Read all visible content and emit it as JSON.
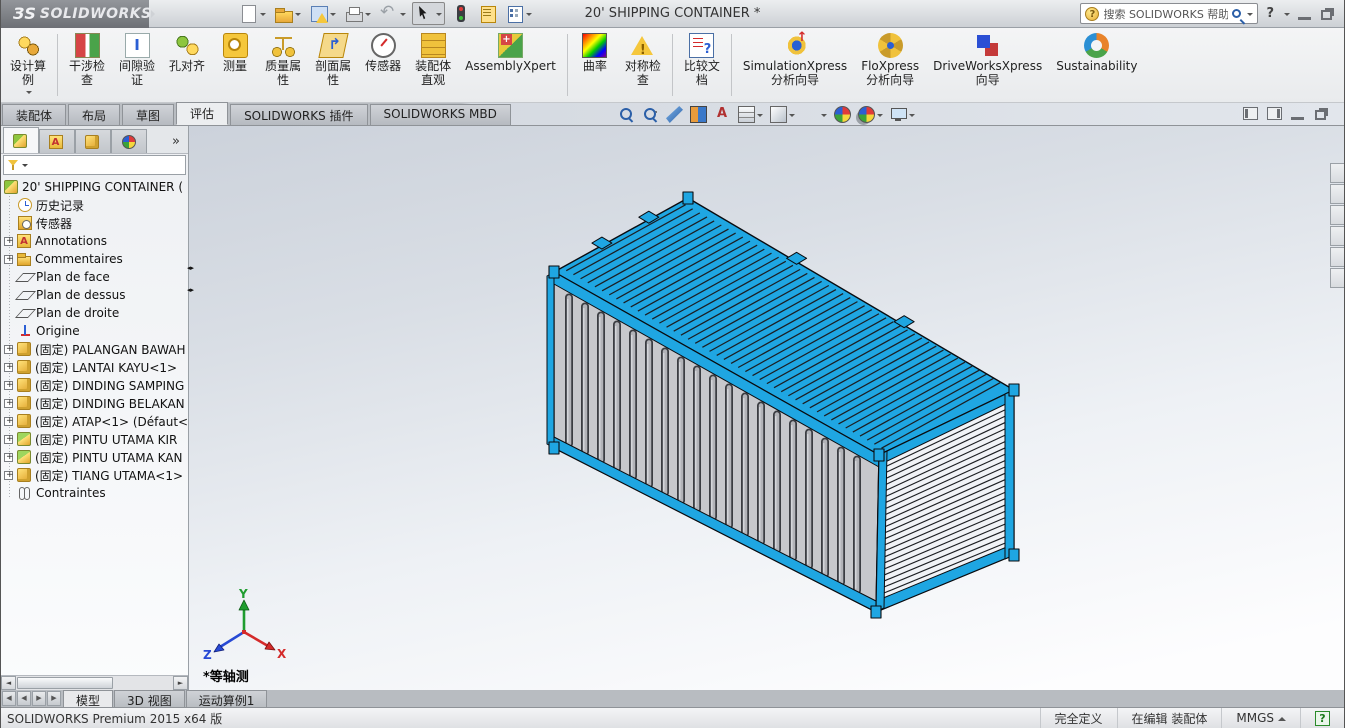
{
  "titlebar": {
    "logo_mark": "ЗS",
    "logo_word": "SOLIDWORKS",
    "title": "20' SHIPPING CONTAINER *",
    "search_placeholder": "搜索 SOLIDWORKS 帮助",
    "quick_icons": [
      {
        "name": "new-document",
        "caret": true
      },
      {
        "name": "open",
        "caret": true
      },
      {
        "name": "save",
        "caret": true
      },
      {
        "name": "print",
        "caret": true
      },
      {
        "name": "undo",
        "caret": true
      },
      {
        "name": "select",
        "caret": true,
        "pressed": true
      },
      {
        "name": "selection-filter",
        "caret": false
      },
      {
        "name": "properties",
        "caret": false
      },
      {
        "name": "options",
        "caret": true
      }
    ]
  },
  "ribbon": {
    "groups": [
      {
        "buttons": [
          {
            "icon": "design-study",
            "lines": [
              "设计算",
              "例"
            ],
            "caret": true
          }
        ]
      },
      {
        "buttons": [
          {
            "icon": "interference",
            "lines": [
              "干涉检",
              "查"
            ]
          },
          {
            "icon": "clearance",
            "lines": [
              "间隙验",
              "证"
            ]
          },
          {
            "icon": "hole-align",
            "lines": [
              "孔对齐"
            ]
          },
          {
            "icon": "measure",
            "lines": [
              "测量"
            ]
          },
          {
            "icon": "mass-props",
            "lines": [
              "质量属",
              "性"
            ]
          },
          {
            "icon": "section-props",
            "lines": [
              "剖面属",
              "性"
            ]
          },
          {
            "icon": "sensor",
            "lines": [
              "传感器"
            ]
          },
          {
            "icon": "assembly-visual",
            "lines": [
              "装配体",
              "直观"
            ]
          },
          {
            "icon": "assemblyxpert",
            "lines": [
              "AssemblyXpert"
            ]
          }
        ]
      },
      {
        "buttons": [
          {
            "icon": "curvature",
            "lines": [
              "曲率"
            ]
          },
          {
            "icon": "symmetry",
            "lines": [
              "对称检",
              "查"
            ]
          }
        ]
      },
      {
        "buttons": [
          {
            "icon": "compare-docs",
            "lines": [
              "比较文",
              "档"
            ]
          }
        ]
      },
      {
        "buttons": [
          {
            "icon": "simulationxpress",
            "lines": [
              "SimulationXpress",
              "分析向导"
            ]
          },
          {
            "icon": "floxpress",
            "lines": [
              "FloXpress",
              "分析向导"
            ]
          },
          {
            "icon": "driveworks",
            "lines": [
              "DriveWorksXpress",
              "向导"
            ]
          },
          {
            "icon": "sustainability",
            "lines": [
              "Sustainability"
            ]
          }
        ]
      }
    ]
  },
  "command_tabs": [
    {
      "label": "装配体",
      "active": false
    },
    {
      "label": "布局",
      "active": false
    },
    {
      "label": "草图",
      "active": false
    },
    {
      "label": "评估",
      "active": true
    },
    {
      "label": "SOLIDWORKS 插件",
      "active": false
    },
    {
      "label": "SOLIDWORKS MBD",
      "active": false
    }
  ],
  "headsup_toolbar": [
    {
      "name": "zoom-fit",
      "caret": false
    },
    {
      "name": "zoom-area",
      "caret": false
    },
    {
      "name": "previous-view",
      "caret": false
    },
    {
      "name": "section-view",
      "caret": false
    },
    {
      "name": "annotation-view",
      "caret": false
    },
    {
      "name": "view-orientation",
      "caret": true
    },
    {
      "name": "display-style",
      "caret": true
    },
    {
      "name": "hide-show-items",
      "caret": true
    },
    {
      "name": "edit-appearance",
      "caret": false
    },
    {
      "name": "apply-scene",
      "caret": true
    },
    {
      "name": "view-settings",
      "caret": true
    }
  ],
  "feature_tree": {
    "header_tabs": [
      "feature-manager",
      "property-manager",
      "configuration-manager",
      "display-manager"
    ],
    "more_label": "»",
    "items": [
      {
        "icon": "assembly",
        "label": "20' SHIPPING CONTAINER (",
        "expander": false,
        "root": true
      },
      {
        "icon": "history",
        "label": "历史记录",
        "expander": false
      },
      {
        "icon": "sensors",
        "label": "传感器",
        "expander": false
      },
      {
        "icon": "annotations",
        "label": "Annotations",
        "expander": true
      },
      {
        "icon": "comments",
        "label": "Commentaires",
        "expander": true
      },
      {
        "icon": "plane",
        "label": "Plan de face",
        "expander": false
      },
      {
        "icon": "plane",
        "label": "Plan de dessus",
        "expander": false
      },
      {
        "icon": "plane",
        "label": "Plan de droite",
        "expander": false
      },
      {
        "icon": "origin",
        "label": "Origine",
        "expander": false
      },
      {
        "icon": "part",
        "label": "(固定) PALANGAN BAWAH",
        "expander": true
      },
      {
        "icon": "part",
        "label": "(固定) LANTAI KAYU<1>",
        "expander": true
      },
      {
        "icon": "part",
        "label": "(固定) DINDING SAMPING",
        "expander": true
      },
      {
        "icon": "part",
        "label": "(固定) DINDING BELAKAN",
        "expander": true
      },
      {
        "icon": "part",
        "label": "(固定) ATAP<1> (Défaut<",
        "expander": true
      },
      {
        "icon": "part-green",
        "label": "(固定) PINTU UTAMA KIR",
        "expander": true
      },
      {
        "icon": "part-green",
        "label": "(固定) PINTU UTAMA KAN",
        "expander": true
      },
      {
        "icon": "part",
        "label": "(固定) TIANG UTAMA<1>",
        "expander": true
      },
      {
        "icon": "mates",
        "label": "Contraintes",
        "expander": false
      }
    ]
  },
  "viewport": {
    "view_label": "*等轴测",
    "triad": {
      "x": "X",
      "y": "Y",
      "z": "Z"
    },
    "model_colors": {
      "blue": "#1FA6E2",
      "blue_light": "#53c2ef",
      "wall_gray": "#C7C8CC",
      "wall_gray_dark": "#b2b3b8",
      "groove_outline": "#3b3d42",
      "end_face": "#F1F3F7",
      "stripe_dark": "#1c1e22",
      "outline": "#0a0c10"
    },
    "task_pane_buttons": 6
  },
  "sheet_tabs": [
    {
      "label": "模型",
      "active": true
    },
    {
      "label": "3D 视图",
      "active": false
    },
    {
      "label": "运动算例1",
      "active": false
    }
  ],
  "statusbar": {
    "product": "SOLIDWORKS Premium 2015 x64 版",
    "fully_defined": "完全定义",
    "editing": "在编辑 装配体",
    "units": "MMGS",
    "help": "?"
  }
}
